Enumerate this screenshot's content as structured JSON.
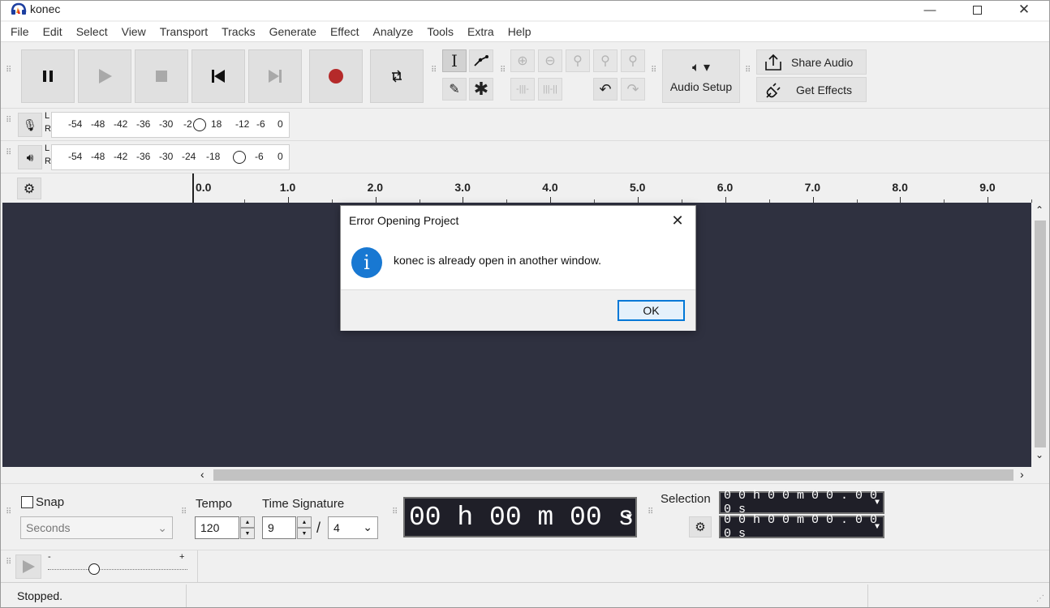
{
  "window": {
    "title": "konec",
    "minimize_icon": "minimize-icon",
    "maximize_icon": "maximize-icon",
    "close_icon": "close-icon"
  },
  "menu": [
    "File",
    "Edit",
    "Select",
    "View",
    "Transport",
    "Tracks",
    "Generate",
    "Effect",
    "Analyze",
    "Tools",
    "Extra",
    "Help"
  ],
  "toolbar": {
    "audio_setup_label": "Audio Setup",
    "share_audio_label": "Share Audio",
    "get_effects_label": "Get Effects"
  },
  "meters": {
    "record_ticks": [
      "-54",
      "-48",
      "-42",
      "-36",
      "-30",
      "-2",
      "18",
      "-12",
      "-6",
      "0"
    ],
    "playback_ticks": [
      "-54",
      "-48",
      "-42",
      "-36",
      "-30",
      "-24",
      "-18",
      "-6",
      "0"
    ],
    "channel_left": "L",
    "channel_right": "R"
  },
  "ruler": {
    "ticks": [
      "0.0",
      "1.0",
      "2.0",
      "3.0",
      "4.0",
      "5.0",
      "6.0",
      "7.0",
      "8.0",
      "9.0"
    ]
  },
  "bottom": {
    "snap_label": "Snap",
    "snap_unit": "Seconds",
    "tempo_label": "Tempo",
    "tempo_value": "120",
    "time_signature_label": "Time Signature",
    "time_sig_top": "9",
    "time_sig_separator": "/",
    "time_sig_bottom": "4",
    "time_display": "00 h 00 m 00 s",
    "selection_label": "Selection",
    "selection_start": "0 0 h 0 0 m 0 0 . 0 0 0 s",
    "selection_end": "0 0 h 0 0 m 0 0 . 0 0 0 s"
  },
  "play_speed": {
    "minus": "-",
    "plus": "+"
  },
  "status": {
    "text": "Stopped."
  },
  "dialog": {
    "title": "Error Opening Project",
    "message": "konec is already open in another window.",
    "ok_label": "OK"
  },
  "colors": {
    "track_bg": "#2f3140",
    "record_red": "#b52a2a",
    "info_blue": "#1878d2",
    "ok_border": "#0078d7"
  }
}
